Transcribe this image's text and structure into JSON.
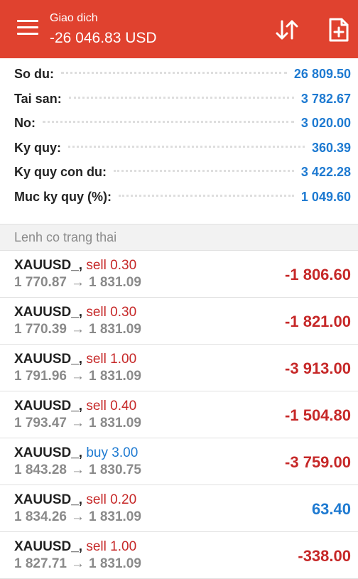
{
  "header": {
    "subtitle": "Giao dich",
    "title": "-26 046.83 USD",
    "icons": {
      "menu": "menu-icon",
      "sort": "sort-icon",
      "new_document": "new-document-icon"
    }
  },
  "summary": [
    {
      "label": "So du:",
      "value": "26 809.50"
    },
    {
      "label": "Tai san:",
      "value": "3 782.67"
    },
    {
      "label": "No:",
      "value": "3 020.00"
    },
    {
      "label": "Ky quy:",
      "value": "360.39"
    },
    {
      "label": "Ky quy con du:",
      "value": "3 422.28"
    },
    {
      "label": "Muc ky quy (%):",
      "value": "1 049.60"
    }
  ],
  "section_label": "Lenh co trang thai",
  "orders": [
    {
      "symbol": "XAUUSD_,",
      "side": "sell",
      "volume": "0.30",
      "open": "1 770.87",
      "arrow": "→",
      "current": "1 831.09",
      "profit": "-1 806.60"
    },
    {
      "symbol": "XAUUSD_,",
      "side": "sell",
      "volume": "0.30",
      "open": "1 770.39",
      "arrow": "→",
      "current": "1 831.09",
      "profit": "-1 821.00"
    },
    {
      "symbol": "XAUUSD_,",
      "side": "sell",
      "volume": "1.00",
      "open": "1 791.96",
      "arrow": "→",
      "current": "1 831.09",
      "profit": "-3 913.00"
    },
    {
      "symbol": "XAUUSD_,",
      "side": "sell",
      "volume": "0.40",
      "open": "1 793.47",
      "arrow": "→",
      "current": "1 831.09",
      "profit": "-1 504.80"
    },
    {
      "symbol": "XAUUSD_,",
      "side": "buy",
      "volume": "3.00",
      "open": "1 843.28",
      "arrow": "→",
      "current": "1 830.75",
      "profit": "-3 759.00"
    },
    {
      "symbol": "XAUUSD_,",
      "side": "sell",
      "volume": "0.20",
      "open": "1 834.26",
      "arrow": "→",
      "current": "1 831.09",
      "profit": "63.40"
    },
    {
      "symbol": "XAUUSD_,",
      "side": "sell",
      "volume": "1.00",
      "open": "1 827.71",
      "arrow": "→",
      "current": "1 831.09",
      "profit": "-338.00"
    }
  ],
  "colors": {
    "header_bg": "#e0422f",
    "value_blue": "#1e7ad1",
    "loss_red": "#c62828",
    "muted_gray": "#8a8a8a"
  }
}
